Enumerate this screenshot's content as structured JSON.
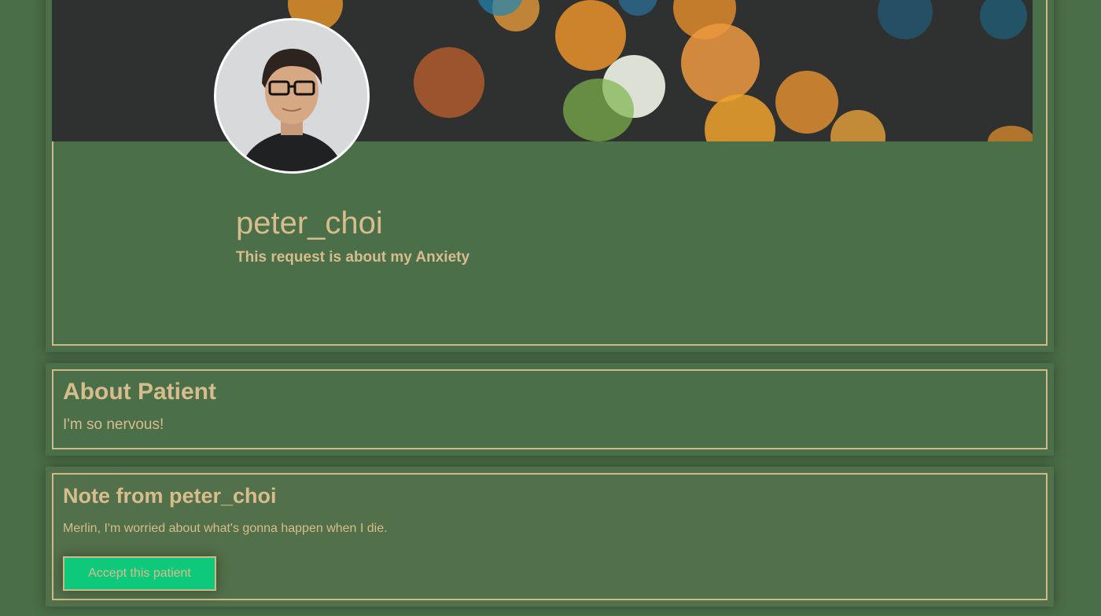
{
  "profile": {
    "username": "peter_choi",
    "request_text": "This request is about my Anxiety"
  },
  "about": {
    "title": "About Patient",
    "text": "I'm so nervous!"
  },
  "note": {
    "title": "Note from peter_choi",
    "text": "Merlin, I'm worried about what's gonna happen when I die.",
    "accept_label": "Accept this patient"
  },
  "colors": {
    "background": "#4a6e48",
    "text_accent": "#d7bd8d",
    "border": "#cfb88a",
    "button": "#0ec87c"
  }
}
